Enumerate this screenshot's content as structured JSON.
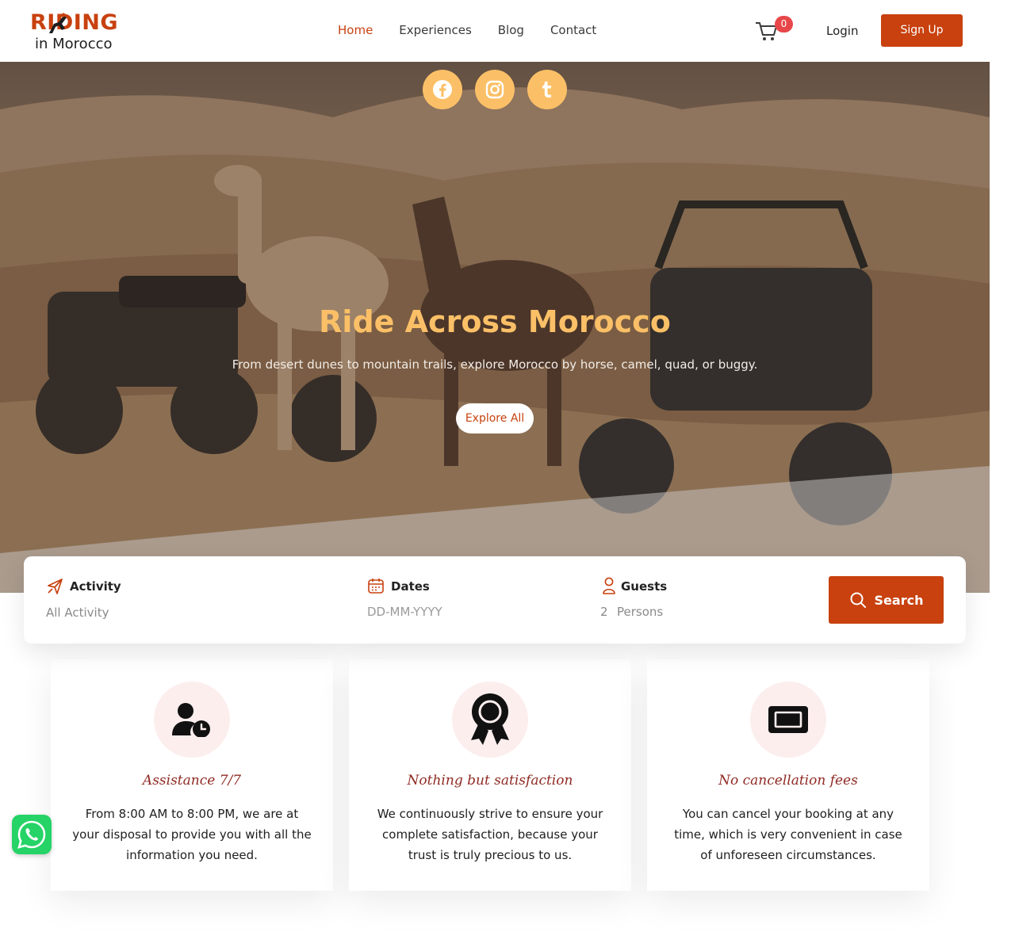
{
  "brand": {
    "logo_top": "RIDING",
    "logo_bottom": "in Morocco"
  },
  "nav": {
    "items": [
      {
        "label": "Home",
        "active": true
      },
      {
        "label": "Experiences",
        "active": false
      },
      {
        "label": "Blog",
        "active": false
      },
      {
        "label": "Contact",
        "active": false
      }
    ]
  },
  "header": {
    "cart_icon": "shopping-cart-icon",
    "cart_count": "0",
    "login_label": "Login",
    "signup_label": "Sign Up"
  },
  "social": [
    {
      "icon": "facebook-icon"
    },
    {
      "icon": "instagram-icon"
    },
    {
      "icon": "tumblr-icon"
    }
  ],
  "hero": {
    "title": "Ride Across Morocco",
    "subtitle": "From desert dunes to mountain trails, explore Morocco by horse, camel, quad, or buggy.",
    "cta_label": "Explore All"
  },
  "search": {
    "activity": {
      "label": "Activity",
      "value": "All Activity",
      "icon": "plane-icon"
    },
    "dates": {
      "label": "Dates",
      "placeholder": "DD-MM-YYYY",
      "icon": "calendar-icon"
    },
    "guests": {
      "label": "Guests",
      "count": "2",
      "unit": "Persons",
      "icon": "user-icon"
    },
    "button_label": "Search",
    "button_icon": "search-icon"
  },
  "features": [
    {
      "icon": "user-clock-icon",
      "title": "Assistance 7/7",
      "text": "From 8:00 AM to 8:00 PM, we are at your disposal to provide you with all the information you need."
    },
    {
      "icon": "award-ribbon-icon",
      "title": "Nothing but satisfaction",
      "text": "We continuously strive to ensure your complete satisfaction, because your trust is truly precious to us."
    },
    {
      "icon": "ticket-icon",
      "title": "No cancellation fees",
      "text": "You can cancel your booking at any time, which is very convenient in case of unforeseen circumstances."
    }
  ],
  "colors": {
    "accent": "#c8410f",
    "hero_title": "#fbc067",
    "badge": "#e8474a",
    "feature_title": "#8f2a23",
    "whatsapp": "#25d366"
  },
  "floating": {
    "whatsapp_icon": "whatsapp-icon"
  }
}
